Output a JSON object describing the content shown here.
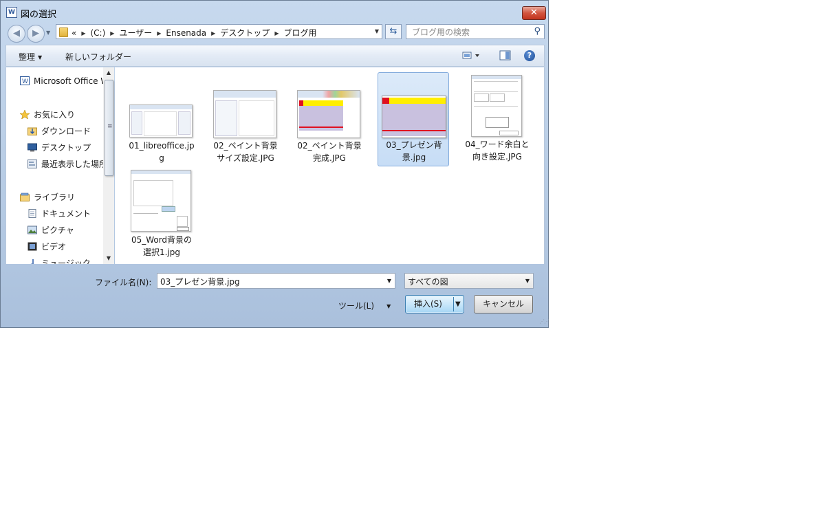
{
  "window": {
    "title": "図の選択",
    "app_icon_text": "W"
  },
  "navigation": {
    "back_icon": "back-arrow-icon",
    "forward_icon": "forward-arrow-icon",
    "breadcrumbs": [
      "«",
      "(C:)",
      "ユーザー",
      "Ensenada",
      "デスクトップ",
      "ブログ用"
    ],
    "search_placeholder": "ブログ用の検索"
  },
  "toolbar": {
    "organize": "整理",
    "new_folder": "新しいフォルダー"
  },
  "nav_pane": {
    "items": [
      {
        "label": "Microsoft Office W",
        "icon": "word-icon",
        "indent": 0
      },
      {
        "label": "お気に入り",
        "icon": "star-icon",
        "indent": 0
      },
      {
        "label": "ダウンロード",
        "icon": "download-folder-icon",
        "indent": 1
      },
      {
        "label": "デスクトップ",
        "icon": "desktop-icon",
        "indent": 1
      },
      {
        "label": "最近表示した場所",
        "icon": "recent-places-icon",
        "indent": 1
      },
      {
        "label": "ライブラリ",
        "icon": "library-icon",
        "indent": 0
      },
      {
        "label": "ドキュメント",
        "icon": "document-icon",
        "indent": 1
      },
      {
        "label": "ピクチャ",
        "icon": "pictures-icon",
        "indent": 1
      },
      {
        "label": "ビデオ",
        "icon": "video-icon",
        "indent": 1
      },
      {
        "label": "ミュージック",
        "icon": "music-icon",
        "indent": 1
      }
    ]
  },
  "files": [
    {
      "line1": "01_libreoffice.jp",
      "line2": "g",
      "selected": false
    },
    {
      "line1": "02_ペイント背景",
      "line2": "サイズ設定.JPG",
      "selected": false
    },
    {
      "line1": "02_ペイント背景",
      "line2": "完成.JPG",
      "selected": false
    },
    {
      "line1": "03_プレゼン背",
      "line2": "景.jpg",
      "selected": true
    },
    {
      "line1": "04_ワード余白と",
      "line2": "向き設定.JPG",
      "selected": false
    },
    {
      "line1": "05_Word背景の",
      "line2": "選択1.jpg",
      "selected": false
    }
  ],
  "bottom": {
    "filename_label": "ファイル名(N):",
    "filename_value": "03_プレゼン背景.jpg",
    "filetype_value": "すべての図",
    "tools_label": "ツール(L)",
    "insert_label": "挿入(S)",
    "cancel_label": "キャンセル"
  },
  "colors": {
    "accent_yellow": "#ffee00",
    "accent_red": "#e01020",
    "lavender": "#c9c1df"
  }
}
